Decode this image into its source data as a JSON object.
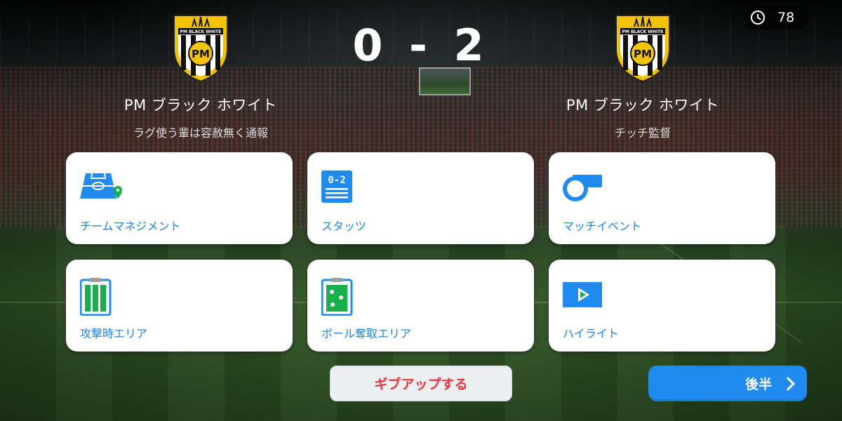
{
  "timer": {
    "value": "78",
    "icon": "stopwatch-icon"
  },
  "match": {
    "score": "0 - 2",
    "home": {
      "name": "PM ブラック ホワイト",
      "subtitle": "ラグ使う輩は容赦無く通報",
      "crest_text": "PM BLACK WHITE",
      "crest_mono": "PM"
    },
    "away": {
      "name": "PM ブラック ホワイト",
      "subtitle": "チッチ監督",
      "crest_text": "PM BLACK WHITE",
      "crest_mono": "PM"
    }
  },
  "menu": {
    "team_management": {
      "label": "チームマネジメント",
      "icon": "formation-field-icon"
    },
    "stats": {
      "label": "スタッツ",
      "icon": "stats-scoreboard-icon",
      "icon_text": "0-2"
    },
    "match_events": {
      "label": "マッチイベント",
      "icon": "whistle-icon"
    },
    "attack_area": {
      "label": "攻撃時エリア",
      "icon": "attack-area-clipboard-icon"
    },
    "ball_recovery_area": {
      "label": "ボール奪取エリア",
      "icon": "ball-recovery-clipboard-icon"
    },
    "highlights": {
      "label": "ハイライト",
      "icon": "play-video-icon"
    }
  },
  "buttons": {
    "give_up": "ギブアップする",
    "second_half": "後半"
  },
  "colors": {
    "accent_blue": "#1f8bf0",
    "label_blue": "#1a86e8",
    "give_up_red": "#e5343a",
    "crest_gold": "#f2c400"
  }
}
